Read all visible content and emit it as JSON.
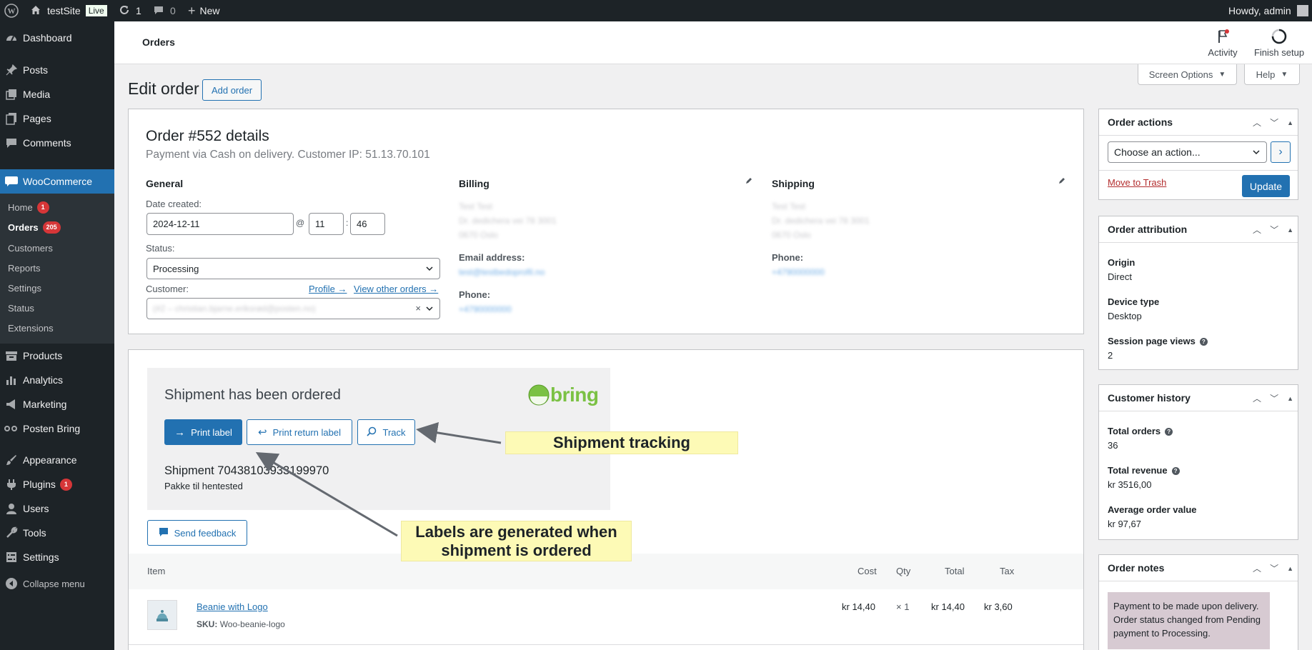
{
  "adminbar": {
    "site_name": "testSite",
    "live_badge": "Live",
    "updates_count": "1",
    "comments_count": "0",
    "new_label": "New",
    "howdy": "Howdy, admin"
  },
  "sidebar": {
    "dashboard": "Dashboard",
    "posts": "Posts",
    "media": "Media",
    "pages": "Pages",
    "comments": "Comments",
    "woocommerce": "WooCommerce",
    "woo_sub": {
      "home": "Home",
      "home_badge": "1",
      "orders": "Orders",
      "orders_badge": "205",
      "customers": "Customers",
      "reports": "Reports",
      "settings": "Settings",
      "status": "Status",
      "extensions": "Extensions"
    },
    "products": "Products",
    "analytics": "Analytics",
    "marketing": "Marketing",
    "posten_bring": "Posten Bring",
    "appearance": "Appearance",
    "plugins": "Plugins",
    "plugins_badge": "1",
    "users": "Users",
    "tools": "Tools",
    "settings": "Settings",
    "collapse": "Collapse menu"
  },
  "header": {
    "title": "Orders",
    "activity": "Activity",
    "finish_setup": "Finish setup"
  },
  "screen_options": "Screen Options",
  "help": "Help",
  "page": {
    "title": "Edit order",
    "add_order": "Add order"
  },
  "order": {
    "title": "Order #552 details",
    "subtitle": "Payment via Cash on delivery. Customer IP: 51.13.70.101",
    "general": "General",
    "date_created_label": "Date created:",
    "date": "2024-12-11",
    "at": "@",
    "hour": "11",
    "colon": ":",
    "minute": "46",
    "status_label": "Status:",
    "status_value": "Processing",
    "customer_label": "Customer:",
    "profile_link": "Profile →",
    "view_orders_link": "View other orders →",
    "customer_value": "(#2 – christian.bjarne.eriksrød@posten.no)",
    "billing": "Billing",
    "billing_address": [
      "Test Test",
      "Dr. dedichera vei 78 3001",
      "0670 Oslo"
    ],
    "email_label": "Email address:",
    "email_value": "test@testbedoprofil.no",
    "billing_phone_label": "Phone:",
    "billing_phone_value": "+4790000000",
    "shipping": "Shipping",
    "shipping_address": [
      "Test Test",
      "Dr. dedichera vei 78 3001",
      "0670 Oslo"
    ],
    "shipping_phone_label": "Phone:",
    "shipping_phone_value": "+4790000000"
  },
  "shipment": {
    "heading": "Shipment has been ordered",
    "logo_text": "bring",
    "print_label": "Print label",
    "print_return": "Print return label",
    "track": "Track",
    "number": "Shipment 70438103933199970",
    "service": "Pakke til hentested",
    "send_feedback": "Send feedback"
  },
  "annotations": {
    "tracking": "Shipment tracking",
    "labels": "Labels are generated when shipment is ordered"
  },
  "items_table": {
    "headers": {
      "item": "Item",
      "cost": "Cost",
      "qty": "Qty",
      "total": "Total",
      "tax": "Tax"
    },
    "rows": [
      {
        "name": "Beanie with Logo",
        "sku_label": "SKU:",
        "sku": "Woo-beanie-logo",
        "cost": "kr 14,40",
        "qty": "× 1",
        "total": "kr 14,40",
        "tax": "kr 3,60"
      }
    ]
  },
  "order_actions": {
    "title": "Order actions",
    "select_value": "Choose an action...",
    "go": "›",
    "trash": "Move to Trash",
    "update": "Update"
  },
  "attribution": {
    "title": "Order attribution",
    "origin_label": "Origin",
    "origin_value": "Direct",
    "device_label": "Device type",
    "device_value": "Desktop",
    "views_label": "Session page views",
    "views_value": "2"
  },
  "history": {
    "title": "Customer history",
    "orders_label": "Total orders",
    "orders_value": "36",
    "revenue_label": "Total revenue",
    "revenue_value": "kr 3516,00",
    "avg_label": "Average order value",
    "avg_value": "kr 97,67"
  },
  "notes": {
    "title": "Order notes",
    "note_text": "Payment to be made upon delivery. Order status changed from Pending payment to Processing."
  },
  "colors": {
    "admin_dark": "#1d2327",
    "wp_blue": "#2271b1",
    "bring_green": "#7bc144",
    "trash_red": "#b32d2e",
    "note_purple": "#d7cad2",
    "annotation_yellow": "#fdfab6"
  }
}
